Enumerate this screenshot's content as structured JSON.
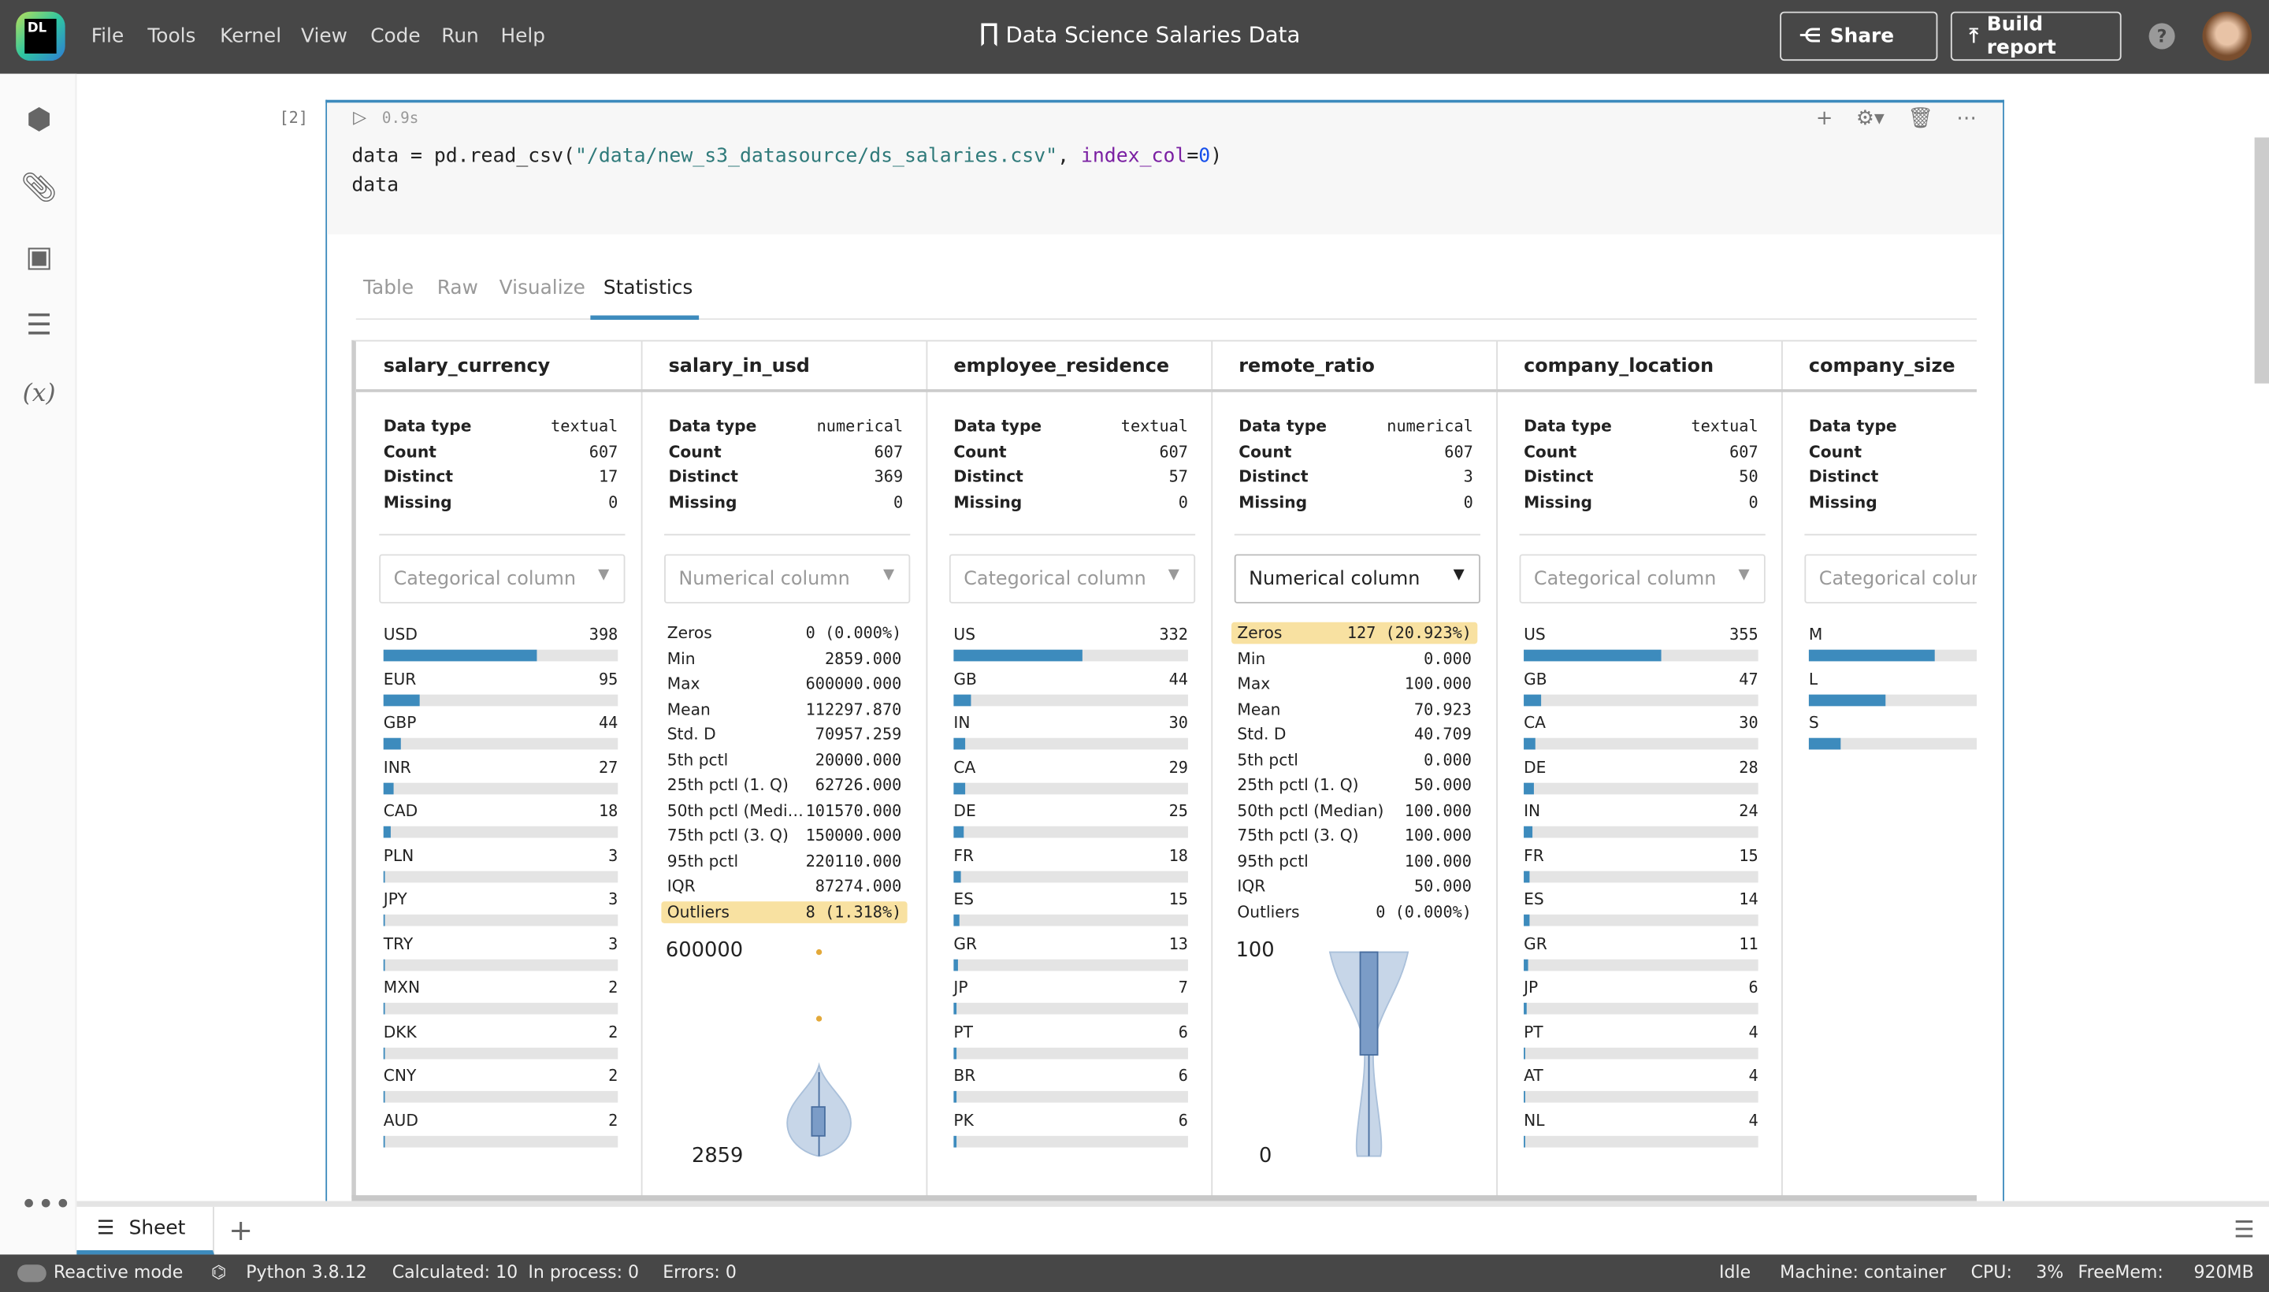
{
  "app": {
    "logo": "DL",
    "menu": [
      "File",
      "Tools",
      "Kernel",
      "View",
      "Code",
      "Run",
      "Help"
    ],
    "title": "Data Science Salaries Data",
    "share": "Share",
    "build_report": "Build report"
  },
  "sidebar": {
    "icons": [
      "package-icon",
      "paperclip-icon",
      "chip-icon",
      "outline-icon",
      "variables-icon",
      "more-icon"
    ]
  },
  "cell": {
    "exec_count": "[2]",
    "time": "0.9s",
    "code": {
      "l1a": "data = pd.read_csv(",
      "l1str": "\"/data/new_s3_datasource/ds_salaries.csv\"",
      "l1b": ", ",
      "l1kw": "index_col",
      "l1eq": "=",
      "l1num": "0",
      "l1c": ")",
      "l2": "data"
    },
    "tabs": [
      "Table",
      "Raw",
      "Visualize",
      "Statistics"
    ],
    "active_tab": "Statistics"
  },
  "stat_labels": [
    "Data type",
    "Count",
    "Distinct",
    "Missing"
  ],
  "columns": [
    {
      "name": "salary_currency",
      "type": "textual",
      "count": "607",
      "distinct": "17",
      "missing": "0",
      "select": "Categorical column",
      "kind": "cat",
      "items": [
        [
          "USD",
          "398",
          0.656
        ],
        [
          "EUR",
          "95",
          0.157
        ],
        [
          "GBP",
          "44",
          0.072
        ],
        [
          "INR",
          "27",
          0.044
        ],
        [
          "CAD",
          "18",
          0.03
        ],
        [
          "PLN",
          "3",
          0.005
        ],
        [
          "JPY",
          "3",
          0.005
        ],
        [
          "TRY",
          "3",
          0.005
        ],
        [
          "MXN",
          "2",
          0.003
        ],
        [
          "DKK",
          "2",
          0.003
        ],
        [
          "CNY",
          "2",
          0.003
        ],
        [
          "AUD",
          "2",
          0.003
        ]
      ]
    },
    {
      "name": "salary_in_usd",
      "type": "numerical",
      "count": "607",
      "distinct": "369",
      "missing": "0",
      "select": "Numerical column",
      "kind": "num",
      "items": [
        [
          "Zeros",
          "0 (0.000%)",
          false
        ],
        [
          "Min",
          "2859.000",
          false
        ],
        [
          "Max",
          "600000.000",
          false
        ],
        [
          "Mean",
          "112297.870",
          false
        ],
        [
          "Std. D",
          "70957.259",
          false
        ],
        [
          "5th pctl",
          "20000.000",
          false
        ],
        [
          "25th pctl (1. Q)",
          "62726.000",
          false
        ],
        [
          "50th pctl (Medi…",
          "101570.000",
          false
        ],
        [
          "75th pctl (3. Q)",
          "150000.000",
          false
        ],
        [
          "95th pctl",
          "220110.000",
          false
        ],
        [
          "IQR",
          "87274.000",
          false
        ],
        [
          "Outliers",
          "8 (1.318%)",
          true
        ]
      ],
      "plot": {
        "max": "600000",
        "min": "2859",
        "type": "violin-with-outliers"
      }
    },
    {
      "name": "employee_residence",
      "type": "textual",
      "count": "607",
      "distinct": "57",
      "missing": "0",
      "select": "Categorical column",
      "kind": "cat",
      "items": [
        [
          "US",
          "332",
          0.547
        ],
        [
          "GB",
          "44",
          0.072
        ],
        [
          "IN",
          "30",
          0.049
        ],
        [
          "CA",
          "29",
          0.048
        ],
        [
          "DE",
          "25",
          0.041
        ],
        [
          "FR",
          "18",
          0.03
        ],
        [
          "ES",
          "15",
          0.025
        ],
        [
          "GR",
          "13",
          0.021
        ],
        [
          "JP",
          "7",
          0.012
        ],
        [
          "PT",
          "6",
          0.01
        ],
        [
          "BR",
          "6",
          0.01
        ],
        [
          "PK",
          "6",
          0.01
        ]
      ]
    },
    {
      "name": "remote_ratio",
      "type": "numerical",
      "count": "607",
      "distinct": "3",
      "missing": "0",
      "select": "Numerical column",
      "kind": "num",
      "select_active": true,
      "items": [
        [
          "Zeros",
          "127 (20.923%)",
          true
        ],
        [
          "Min",
          "0.000",
          false
        ],
        [
          "Max",
          "100.000",
          false
        ],
        [
          "Mean",
          "70.923",
          false
        ],
        [
          "Std. D",
          "40.709",
          false
        ],
        [
          "5th pctl",
          "0.000",
          false
        ],
        [
          "25th pctl (1. Q)",
          "50.000",
          false
        ],
        [
          "50th pctl (Median)",
          "100.000",
          false
        ],
        [
          "75th pctl (3. Q)",
          "100.000",
          false
        ],
        [
          "95th pctl",
          "100.000",
          false
        ],
        [
          "IQR",
          "50.000",
          false
        ],
        [
          "Outliers",
          "0 (0.000%)",
          false
        ]
      ],
      "plot": {
        "max": "100",
        "min": "0",
        "type": "violin-hourglass"
      }
    },
    {
      "name": "company_location",
      "type": "textual",
      "count": "607",
      "distinct": "50",
      "missing": "0",
      "select": "Categorical column",
      "kind": "cat",
      "items": [
        [
          "US",
          "355",
          0.585
        ],
        [
          "GB",
          "47",
          0.077
        ],
        [
          "CA",
          "30",
          0.049
        ],
        [
          "DE",
          "28",
          0.046
        ],
        [
          "IN",
          "24",
          0.04
        ],
        [
          "FR",
          "15",
          0.025
        ],
        [
          "ES",
          "14",
          0.023
        ],
        [
          "GR",
          "11",
          0.018
        ],
        [
          "JP",
          "6",
          0.01
        ],
        [
          "PT",
          "4",
          0.007
        ],
        [
          "AT",
          "4",
          0.007
        ],
        [
          "NL",
          "4",
          0.007
        ]
      ]
    },
    {
      "name": "company_size",
      "type": "",
      "count": "",
      "distinct": "",
      "missing": "",
      "select": "Categorical column",
      "kind": "cat",
      "items": [
        [
          "M",
          "",
          0.537
        ],
        [
          "L",
          "",
          0.326
        ],
        [
          "S",
          "",
          0.137
        ]
      ]
    }
  ],
  "bottom": {
    "sheet_tab": "Sheet",
    "add": "+"
  },
  "status": {
    "reactive": "Reactive mode",
    "python": "Python 3.8.12",
    "calculated": "Calculated: 10",
    "in_process": "In process: 0",
    "errors": "Errors: 0",
    "idle": "Idle",
    "machine": "Machine: container",
    "cpu_label": "CPU:",
    "cpu": "3%",
    "freemem_label": "FreeMem:",
    "freemem": "920MB"
  },
  "colors": {
    "accent": "#3d8bbd",
    "highlight": "#f8e1a1",
    "topbar": "#474747"
  }
}
